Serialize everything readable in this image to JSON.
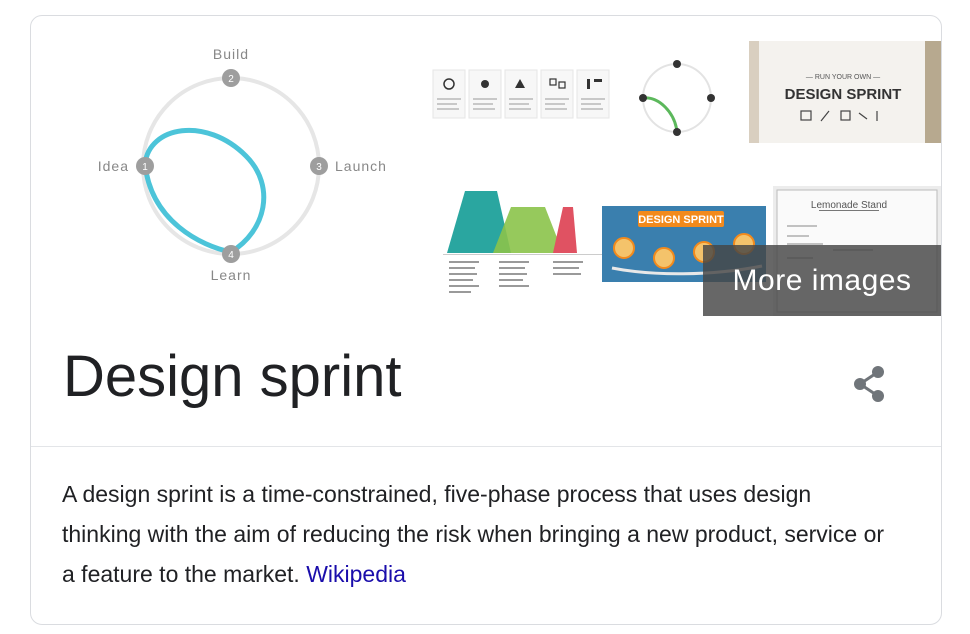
{
  "diagram": {
    "labels": [
      {
        "num": "2",
        "text": "Build"
      },
      {
        "num": "3",
        "text": "Launch"
      },
      {
        "num": "1",
        "text": "Idea"
      },
      {
        "num": "4",
        "text": "Learn"
      }
    ]
  },
  "thumb_b": {
    "heading": "— RUN YOUR OWN —",
    "title": "DESIGN SPRINT"
  },
  "thumb_e": {
    "title": "DESIGN SPRINT"
  },
  "thumb_f": {
    "title": "Lemonade Stand"
  },
  "more_images": "More images",
  "entity": {
    "title": "Design sprint",
    "description": "A design sprint is a time-constrained, five-phase process that uses design thinking with the aim of reducing the risk when bringing a new product, service or a feature to the market. ",
    "source_link": "Wikipedia"
  },
  "colors": {
    "cycle_accent": "#4cc4d9",
    "link": "#1a0dab",
    "text": "#202124",
    "border": "#dadce0"
  }
}
